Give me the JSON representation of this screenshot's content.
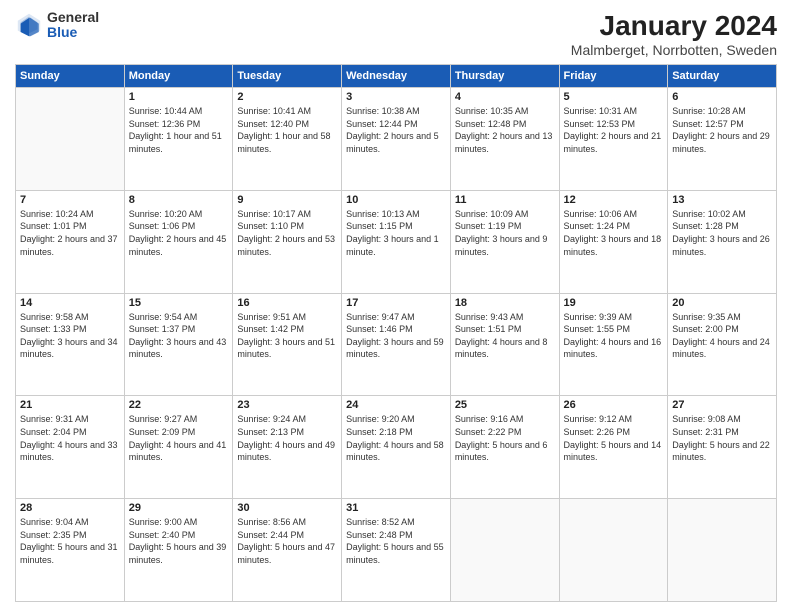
{
  "header": {
    "logo_general": "General",
    "logo_blue": "Blue",
    "title": "January 2024",
    "location": "Malmberget, Norrbotten, Sweden"
  },
  "weekdays": [
    "Sunday",
    "Monday",
    "Tuesday",
    "Wednesday",
    "Thursday",
    "Friday",
    "Saturday"
  ],
  "weeks": [
    [
      {
        "day": "",
        "info": ""
      },
      {
        "day": "1",
        "info": "Sunrise: 10:44 AM\nSunset: 12:36 PM\nDaylight: 1 hour and 51 minutes."
      },
      {
        "day": "2",
        "info": "Sunrise: 10:41 AM\nSunset: 12:40 PM\nDaylight: 1 hour and 58 minutes."
      },
      {
        "day": "3",
        "info": "Sunrise: 10:38 AM\nSunset: 12:44 PM\nDaylight: 2 hours and 5 minutes."
      },
      {
        "day": "4",
        "info": "Sunrise: 10:35 AM\nSunset: 12:48 PM\nDaylight: 2 hours and 13 minutes."
      },
      {
        "day": "5",
        "info": "Sunrise: 10:31 AM\nSunset: 12:53 PM\nDaylight: 2 hours and 21 minutes."
      },
      {
        "day": "6",
        "info": "Sunrise: 10:28 AM\nSunset: 12:57 PM\nDaylight: 2 hours and 29 minutes."
      }
    ],
    [
      {
        "day": "7",
        "info": "Sunrise: 10:24 AM\nSunset: 1:01 PM\nDaylight: 2 hours and 37 minutes."
      },
      {
        "day": "8",
        "info": "Sunrise: 10:20 AM\nSunset: 1:06 PM\nDaylight: 2 hours and 45 minutes."
      },
      {
        "day": "9",
        "info": "Sunrise: 10:17 AM\nSunset: 1:10 PM\nDaylight: 2 hours and 53 minutes."
      },
      {
        "day": "10",
        "info": "Sunrise: 10:13 AM\nSunset: 1:15 PM\nDaylight: 3 hours and 1 minute."
      },
      {
        "day": "11",
        "info": "Sunrise: 10:09 AM\nSunset: 1:19 PM\nDaylight: 3 hours and 9 minutes."
      },
      {
        "day": "12",
        "info": "Sunrise: 10:06 AM\nSunset: 1:24 PM\nDaylight: 3 hours and 18 minutes."
      },
      {
        "day": "13",
        "info": "Sunrise: 10:02 AM\nSunset: 1:28 PM\nDaylight: 3 hours and 26 minutes."
      }
    ],
    [
      {
        "day": "14",
        "info": "Sunrise: 9:58 AM\nSunset: 1:33 PM\nDaylight: 3 hours and 34 minutes."
      },
      {
        "day": "15",
        "info": "Sunrise: 9:54 AM\nSunset: 1:37 PM\nDaylight: 3 hours and 43 minutes."
      },
      {
        "day": "16",
        "info": "Sunrise: 9:51 AM\nSunset: 1:42 PM\nDaylight: 3 hours and 51 minutes."
      },
      {
        "day": "17",
        "info": "Sunrise: 9:47 AM\nSunset: 1:46 PM\nDaylight: 3 hours and 59 minutes."
      },
      {
        "day": "18",
        "info": "Sunrise: 9:43 AM\nSunset: 1:51 PM\nDaylight: 4 hours and 8 minutes."
      },
      {
        "day": "19",
        "info": "Sunrise: 9:39 AM\nSunset: 1:55 PM\nDaylight: 4 hours and 16 minutes."
      },
      {
        "day": "20",
        "info": "Sunrise: 9:35 AM\nSunset: 2:00 PM\nDaylight: 4 hours and 24 minutes."
      }
    ],
    [
      {
        "day": "21",
        "info": "Sunrise: 9:31 AM\nSunset: 2:04 PM\nDaylight: 4 hours and 33 minutes."
      },
      {
        "day": "22",
        "info": "Sunrise: 9:27 AM\nSunset: 2:09 PM\nDaylight: 4 hours and 41 minutes."
      },
      {
        "day": "23",
        "info": "Sunrise: 9:24 AM\nSunset: 2:13 PM\nDaylight: 4 hours and 49 minutes."
      },
      {
        "day": "24",
        "info": "Sunrise: 9:20 AM\nSunset: 2:18 PM\nDaylight: 4 hours and 58 minutes."
      },
      {
        "day": "25",
        "info": "Sunrise: 9:16 AM\nSunset: 2:22 PM\nDaylight: 5 hours and 6 minutes."
      },
      {
        "day": "26",
        "info": "Sunrise: 9:12 AM\nSunset: 2:26 PM\nDaylight: 5 hours and 14 minutes."
      },
      {
        "day": "27",
        "info": "Sunrise: 9:08 AM\nSunset: 2:31 PM\nDaylight: 5 hours and 22 minutes."
      }
    ],
    [
      {
        "day": "28",
        "info": "Sunrise: 9:04 AM\nSunset: 2:35 PM\nDaylight: 5 hours and 31 minutes."
      },
      {
        "day": "29",
        "info": "Sunrise: 9:00 AM\nSunset: 2:40 PM\nDaylight: 5 hours and 39 minutes."
      },
      {
        "day": "30",
        "info": "Sunrise: 8:56 AM\nSunset: 2:44 PM\nDaylight: 5 hours and 47 minutes."
      },
      {
        "day": "31",
        "info": "Sunrise: 8:52 AM\nSunset: 2:48 PM\nDaylight: 5 hours and 55 minutes."
      },
      {
        "day": "",
        "info": ""
      },
      {
        "day": "",
        "info": ""
      },
      {
        "day": "",
        "info": ""
      }
    ]
  ]
}
